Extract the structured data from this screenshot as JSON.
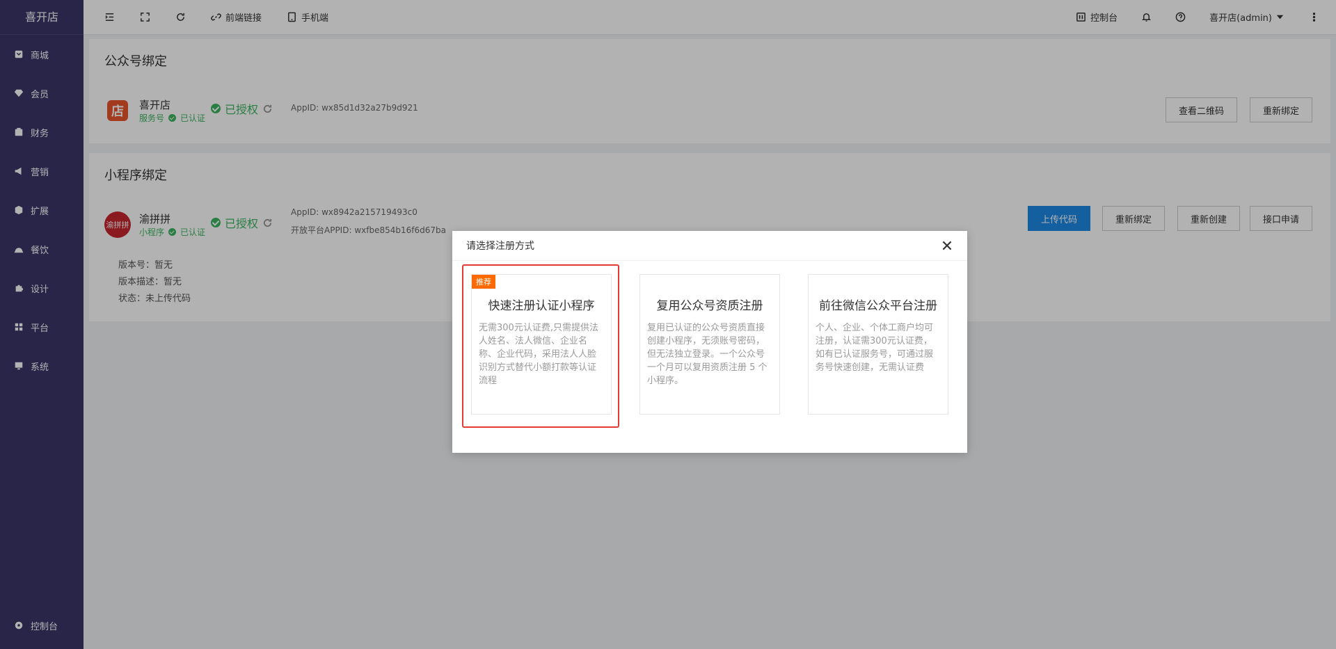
{
  "app": {
    "brand": "喜开店"
  },
  "sidebar": {
    "items": [
      {
        "label": "商城",
        "icon": "shop-icon"
      },
      {
        "label": "会员",
        "icon": "diamond-icon"
      },
      {
        "label": "财务",
        "icon": "wallet-icon"
      },
      {
        "label": "营销",
        "icon": "megaphone-icon"
      },
      {
        "label": "扩展",
        "icon": "cube-icon"
      },
      {
        "label": "餐饮",
        "icon": "cloche-icon"
      },
      {
        "label": "设计",
        "icon": "puzzle-icon"
      },
      {
        "label": "平台",
        "icon": "grid-icon"
      },
      {
        "label": "系统",
        "icon": "monitor-icon"
      }
    ],
    "bottom": {
      "label": "控制台",
      "icon": "gear-icon"
    }
  },
  "topbar": {
    "frontend_link": "前端链接",
    "mobile": "手机端",
    "console": "控制台",
    "user": "喜开店(admin)"
  },
  "official": {
    "title": "公众号绑定",
    "name": "喜开店",
    "type": "服务号",
    "verified": "已认证",
    "auth": "已授权",
    "appid": "AppID:   wx85d1d32a27b9d921",
    "btn_qr": "查看二维码",
    "btn_rebind": "重新绑定"
  },
  "mini": {
    "title": "小程序绑定",
    "name": "渝拼拼",
    "logo_text": "渝拼拼",
    "type": "小程序",
    "verified": "已认证",
    "auth": "已授权",
    "appid": "AppID:   wx8942a215719493c0",
    "open_appid": "开放平台APPID:   wxfbe854b16f6d67ba",
    "btn_upload": "上传代码",
    "btn_rebind": "重新绑定",
    "btn_recreate": "重新创建",
    "btn_api": "接口申请",
    "version": "版本号：暂无",
    "version_desc": "版本描述：暂无",
    "status": "状态：未上传代码"
  },
  "modal": {
    "title": "请选择注册方式",
    "options": [
      {
        "badge": "推荐",
        "title": "快速注册认证小程序",
        "desc": "无需300元认证费,只需提供法人姓名、法人微信、企业名称、企业代码，采用法人人脸识别方式替代小额打款等认证流程"
      },
      {
        "title": "复用公众号资质注册",
        "desc": "复用已认证的公众号资质直接创建小程序，无须账号密码，但无法独立登录。一个公众号一个月可以复用资质注册 5 个小程序。"
      },
      {
        "title": "前往微信公众平台注册",
        "desc": "个人、企业、个体工商户均可注册，认证需300元认证费，如有已认证服务号，可通过服务号快速创建，无需认证费"
      }
    ]
  },
  "colors": {
    "sidebar": "#3a3669",
    "primary": "#1e88e5",
    "success": "#3bb560",
    "badge": "#ff6a00",
    "highlight": "#e53935"
  }
}
